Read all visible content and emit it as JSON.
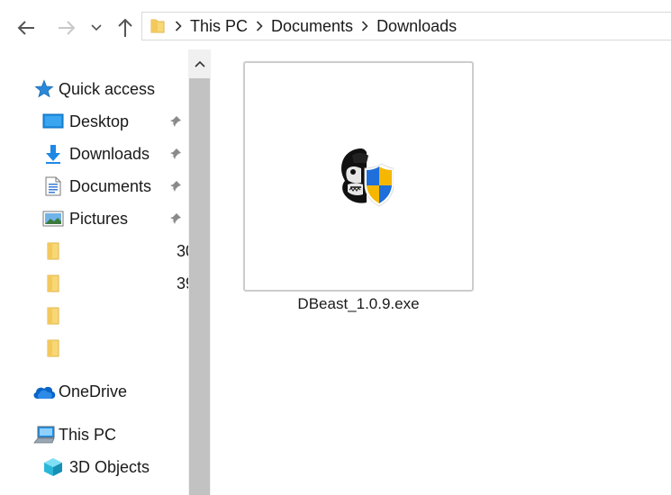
{
  "toolbar": {
    "back_icon": "arrow-left-icon",
    "forward_icon": "arrow-right-icon",
    "recent_icon": "chevron-down-icon",
    "up_icon": "arrow-up-icon"
  },
  "address": {
    "breadcrumbs": [
      "This PC",
      "Documents",
      "Downloads"
    ]
  },
  "nav": {
    "quick_access": "Quick access",
    "pinned": [
      {
        "label": "Desktop",
        "icon": "desktop-icon"
      },
      {
        "label": "Downloads",
        "icon": "download-arrow-icon"
      },
      {
        "label": "Documents",
        "icon": "document-icon"
      },
      {
        "label": "Pictures",
        "icon": "pictures-icon"
      }
    ],
    "folders": [
      {
        "suffix": "30"
      },
      {
        "suffix": "39"
      },
      {
        "suffix": ""
      },
      {
        "suffix": ""
      }
    ],
    "onedrive": "OneDrive",
    "this_pc": "This PC",
    "objects_3d": "3D Objects"
  },
  "files": [
    {
      "name": "DBeast_1.0.9.exe",
      "icon": "gorilla-shield-app-icon"
    }
  ],
  "colors": {
    "folder": "#f8d775",
    "accent_blue": "#0078d7",
    "scrollbar_thumb": "#c2c2c2"
  }
}
